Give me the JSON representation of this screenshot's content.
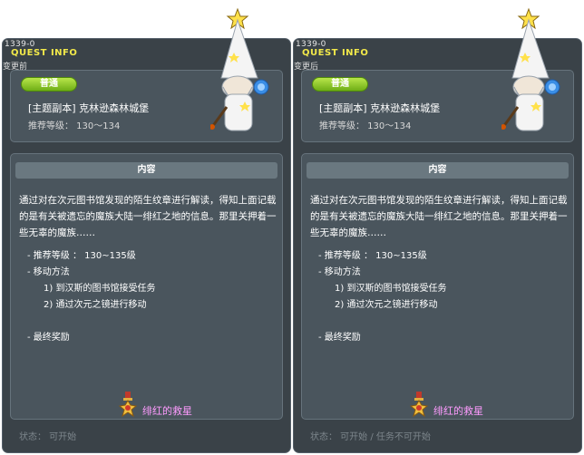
{
  "left": {
    "quest_id": "1339-0",
    "title": "QUEST INFO",
    "note": "变更前",
    "badge": "普通",
    "quest_name": "[主题副本] 克林逊森林城堡",
    "recommended_level": "推荐等级： 130～134",
    "section_title": "内容",
    "description": "通过对在次元图书馆发现的陌生纹章进行解读，得知上面记载的是有关被遗忘的魔族大陆一绯红之地的信息。那里关押着一些无辜的魔族……",
    "details": {
      "level_line": "- 推荐等级   ： 130~135级",
      "move_method": "- 移动方法",
      "step1": "1) 到汉斯的图书馆接受任务",
      "step2": "2) 通过次元之镜进行移动",
      "reward_label": "- 最终奖励"
    },
    "reward_name": "绯红的救星",
    "status": "状态： 可开始"
  },
  "right": {
    "quest_id": "1339-0",
    "title": "QUEST INFO",
    "note": "变更后",
    "badge": "普通",
    "quest_name": "[主题副本] 克林逊森林城堡",
    "recommended_level": "推荐等级： 130～134",
    "section_title": "内容",
    "description": "通过对在次元图书馆发现的陌生纹章进行解读，得知上面记载的是有关被遗忘的魔族大陆一绯红之地的信息。那里关押着一些无辜的魔族……",
    "details": {
      "level_line": "- 推荐等级   ： 130~135级",
      "move_method": "- 移动方法",
      "step1": "1) 到汉斯的图书馆接受任务",
      "step2": "2) 通过次元之镜进行移动",
      "reward_label": "- 最终奖励"
    },
    "reward_name": "绯红的救星",
    "status": "状态： 可开始 / 任务不可开始"
  },
  "icons": {
    "wizard": "wizard-npc-icon",
    "reward": "medal-icon"
  },
  "colors": {
    "panel_bg": "#3a4248",
    "box_bg": "#4a555d",
    "title": "#f2e94a",
    "badge": "#8fcd20",
    "reward_name": "#ff9cff"
  }
}
